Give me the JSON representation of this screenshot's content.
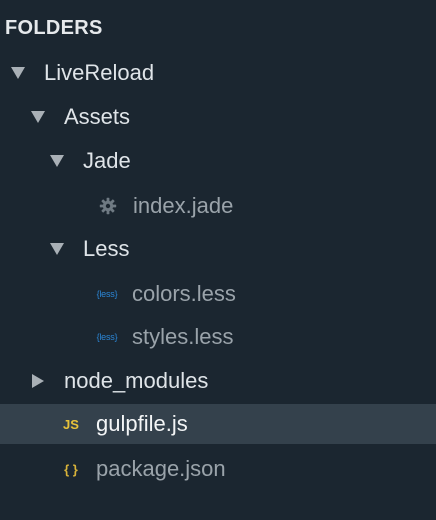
{
  "header": {
    "title": "FOLDERS"
  },
  "tree": [
    {
      "label": "LiveReload",
      "kind": "folder",
      "state": "expanded",
      "icon": "triangle-down-icon"
    },
    {
      "label": "Assets",
      "kind": "folder",
      "state": "expanded",
      "icon": "triangle-down-icon"
    },
    {
      "label": "Jade",
      "kind": "folder",
      "state": "expanded",
      "icon": "triangle-down-icon"
    },
    {
      "label": "index.jade",
      "kind": "file",
      "icon": "gear-icon"
    },
    {
      "label": "Less",
      "kind": "folder",
      "state": "expanded",
      "icon": "triangle-down-icon"
    },
    {
      "label": "colors.less",
      "kind": "file",
      "icon": "less-file-icon",
      "icon_text": "{less}"
    },
    {
      "label": "styles.less",
      "kind": "file",
      "icon": "less-file-icon",
      "icon_text": "{less}"
    },
    {
      "label": "node_modules",
      "kind": "folder",
      "state": "collapsed",
      "icon": "triangle-right-icon"
    },
    {
      "label": "gulpfile.js",
      "kind": "file",
      "selected": true,
      "icon": "js-file-icon",
      "icon_text": "JS"
    },
    {
      "label": "package.json",
      "kind": "file",
      "icon": "json-file-icon",
      "icon_text": "{ }"
    }
  ],
  "colors": {
    "background": "#1b2630",
    "selected_row": "#34414c",
    "less_icon": "#2b86d6",
    "js_icon": "#e8c23a"
  }
}
